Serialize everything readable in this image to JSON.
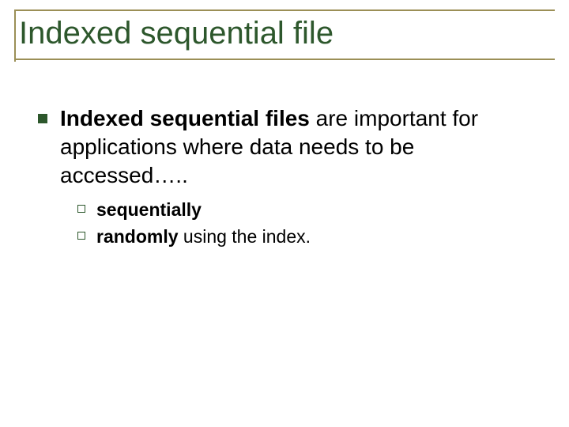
{
  "title": "Indexed sequential file",
  "main": {
    "bold_lead": "Indexed sequential files",
    "rest": " are important for applications where data needs to be accessed….."
  },
  "subitems": [
    {
      "bold": "sequentially",
      "rest": ""
    },
    {
      "bold": "randomly",
      "rest": " using the index."
    }
  ]
}
